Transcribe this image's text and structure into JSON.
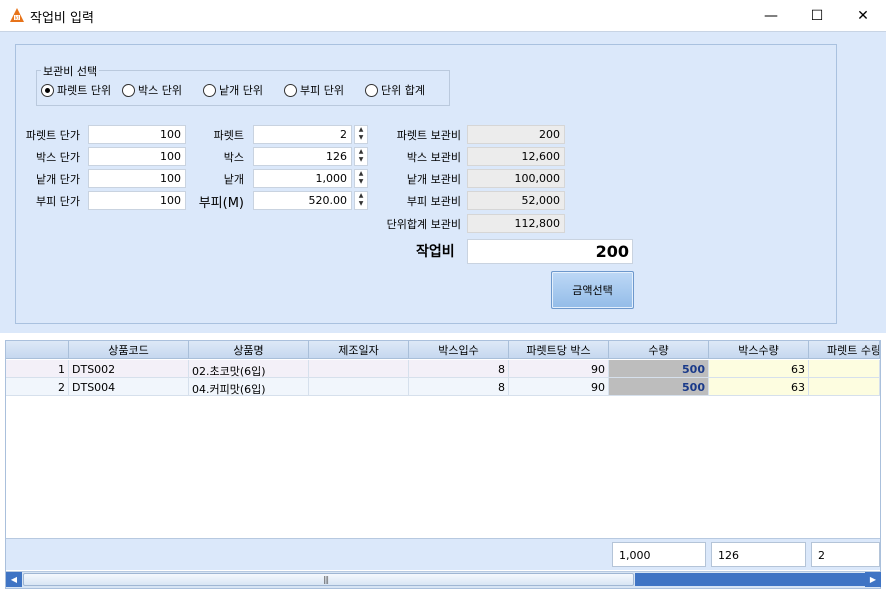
{
  "window": {
    "title": "작업비 입력",
    "minimize": "—",
    "maximize": "☐",
    "close": "✕"
  },
  "unit_group": {
    "legend": "보관비 선택",
    "options": [
      "파렛트 단위",
      "박스 단위",
      "낱개 단위",
      "부피 단위",
      "단위 합계"
    ],
    "selected": 0
  },
  "prices": {
    "pallet": {
      "label": "파렛트 단가",
      "value": "100"
    },
    "box": {
      "label": "박스 단가",
      "value": "100"
    },
    "piece": {
      "label": "낱개 단가",
      "value": "100"
    },
    "volume": {
      "label": "부피 단가",
      "value": "100"
    }
  },
  "quantities": {
    "pallet": {
      "label": "파렛트",
      "value": "2"
    },
    "box": {
      "label": "박스",
      "value": "126"
    },
    "piece": {
      "label": "낱개",
      "value": "1,000"
    },
    "volume": {
      "label": "부피(M)",
      "value": "520.00"
    }
  },
  "storage_fees": {
    "pallet": {
      "label": "파렛트 보관비",
      "value": "200"
    },
    "box": {
      "label": "박스 보관비",
      "value": "12,600"
    },
    "piece": {
      "label": "낱개 보관비",
      "value": "100,000"
    },
    "volume": {
      "label": "부피 보관비",
      "value": "52,000"
    },
    "total": {
      "label": "단위합계 보관비",
      "value": "112,800"
    }
  },
  "work_fee": {
    "label": "작업비",
    "value": "200"
  },
  "amount_button": "금액선택",
  "grid": {
    "columns": [
      "",
      "상품코드",
      "상품명",
      "제조일자",
      "박스입수",
      "파렛트당 박스",
      "수량",
      "박스수량",
      "파렛트 수량"
    ],
    "rows": [
      [
        "1",
        "DTS002",
        "02.초코맛(6입)",
        "",
        "8",
        "90",
        "500",
        "63",
        ""
      ],
      [
        "2",
        "DTS004",
        "04.커피맛(6입)",
        "",
        "8",
        "90",
        "500",
        "63",
        ""
      ]
    ],
    "footer": {
      "qty_total": "1,000",
      "box_total": "126",
      "pallet_total": "2"
    }
  },
  "colors": {
    "panel": "#dbe8fa",
    "button": "#93bce8",
    "scroll_track": "#3f74c4",
    "qty_cell": "#bdbdbd",
    "box_qty_cell": "#fdfde0"
  }
}
